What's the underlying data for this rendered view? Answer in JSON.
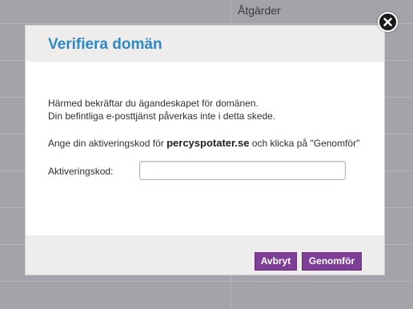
{
  "background": {
    "column_header": "Åtgärder"
  },
  "modal": {
    "title": "Verifiera domän",
    "intro_line1": "Härmed bekräftar du ägandeskapet för domänen.",
    "intro_line2": "Din befintliga e-posttjänst påverkas inte i detta skede.",
    "instruction_prefix": "Ange din aktiveringskod för ",
    "domain": "percyspotater.se",
    "instruction_suffix": " och klicka på \"Genomför\"",
    "code_label": "Aktiveringskod:",
    "code_value": "",
    "cancel_label": "Avbryt",
    "submit_label": "Genomför"
  },
  "colors": {
    "title": "#2e89c7",
    "button": "#7d3e96",
    "overlay": "#a6a2aa",
    "header_footer": "#efedec"
  },
  "icons": {
    "close": "close-icon"
  }
}
